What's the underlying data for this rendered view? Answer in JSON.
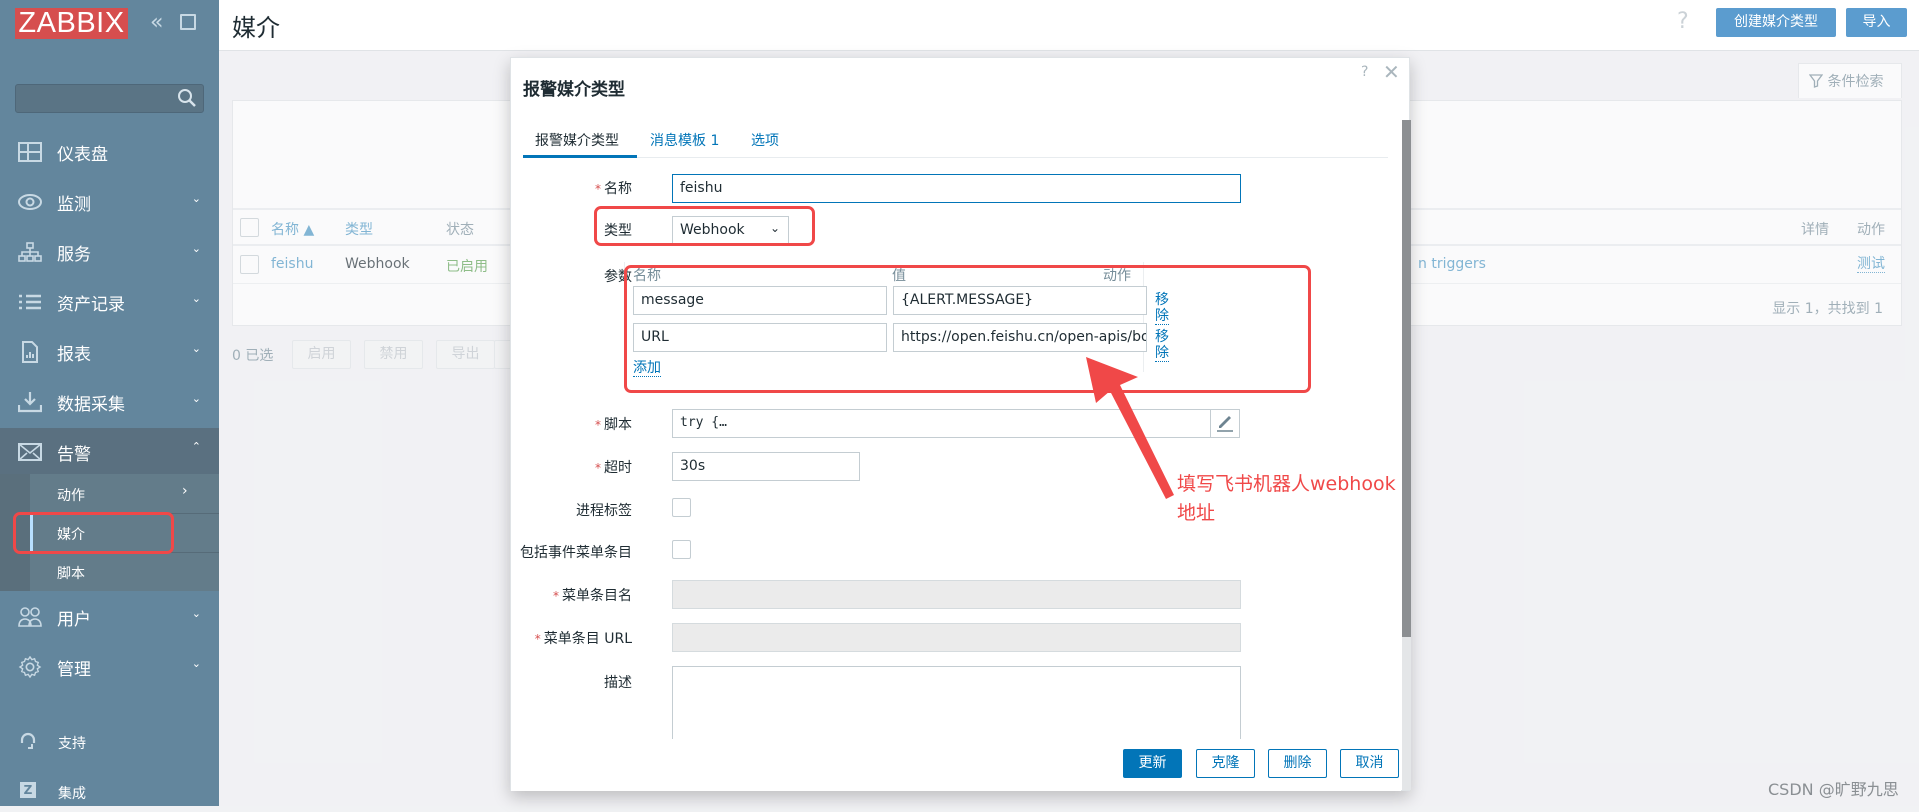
{
  "sidebar": {
    "logo": "ZABBIX",
    "collapse_icon": "double-chevron-left-icon",
    "kiosk_icon": "kiosk-mode-icon",
    "search_placeholder": "",
    "items": [
      {
        "label": "仪表盘",
        "icon": "dashboard-icon"
      },
      {
        "label": "监测",
        "icon": "eye-icon"
      },
      {
        "label": "服务",
        "icon": "hierarchy-icon"
      },
      {
        "label": "资产记录",
        "icon": "list-icon"
      },
      {
        "label": "报表",
        "icon": "report-icon"
      },
      {
        "label": "数据采集",
        "icon": "download-icon"
      },
      {
        "label": "告警",
        "icon": "envelope-icon"
      },
      {
        "label": "用户",
        "icon": "users-icon"
      },
      {
        "label": "管理",
        "icon": "gear-icon"
      }
    ],
    "alerts_sub": [
      {
        "label": "动作"
      },
      {
        "label": "媒介"
      },
      {
        "label": "脚本"
      }
    ],
    "footer": [
      {
        "label": "支持",
        "icon": "headset-icon"
      },
      {
        "label": "集成",
        "icon": "z-integration-icon"
      }
    ]
  },
  "header": {
    "title": "媒介",
    "help": "?",
    "create_button": "创建媒介类型",
    "import_button": "导入",
    "filter_tab": "条件检索"
  },
  "table": {
    "columns": [
      "名称 ▲",
      "类型",
      "状态",
      "详情",
      "动作"
    ],
    "rows": [
      {
        "name": "feishu",
        "type": "Webhook",
        "status": "已启用",
        "used_in": "n triggers",
        "action": "测试"
      }
    ],
    "found_text": "显示 1，共找到 1",
    "selected_text": "0 已选",
    "mass_buttons": [
      "启用",
      "禁用",
      "导出"
    ]
  },
  "modal": {
    "title": "报警媒介类型",
    "help": "?",
    "close": "✕",
    "tabs": [
      {
        "label": "报警媒介类型",
        "active": true
      },
      {
        "label": "消息模板 1",
        "active": false
      },
      {
        "label": "选项",
        "active": false
      }
    ],
    "fields": {
      "name_label": "名称",
      "name_value": "feishu",
      "type_label": "类型",
      "type_value": "Webhook",
      "params_label": "参数",
      "params_headers": [
        "名称",
        "值",
        "动作"
      ],
      "params": [
        {
          "name": "message",
          "value": "{ALERT.MESSAGE}",
          "action": "移除"
        },
        {
          "name": "URL",
          "value": "https://open.feishu.cn/open-apis/bot/",
          "action": "移除"
        }
      ],
      "add_link": "添加",
      "script_label": "脚本",
      "script_value": "try {…",
      "timeout_label": "超时",
      "timeout_value": "30s",
      "process_tags_label": "进程标签",
      "include_menu_label": "包括事件菜单条目",
      "menu_name_label": "菜单条目名",
      "menu_url_label": "菜单条目 URL",
      "description_label": "描述",
      "description_value": ""
    },
    "buttons": {
      "update": "更新",
      "clone": "克隆",
      "delete": "删除",
      "cancel": "取消"
    }
  },
  "annotation": {
    "line1": "填写飞书机器人webhook",
    "line2": "地址"
  },
  "watermark": "CSDN @旷野九思",
  "colors": {
    "sidebar": "#63869d",
    "logo": "#d64e4e",
    "primary": "#0275b8",
    "header_button": "#5b9ccf",
    "enabled_status": "#59a14f",
    "annotation_red": "#f04848"
  }
}
